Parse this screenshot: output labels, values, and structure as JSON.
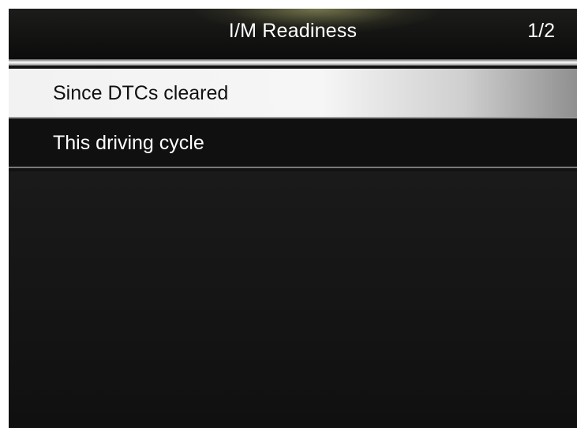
{
  "header": {
    "title": "I/M Readiness",
    "page_indicator": "1/2"
  },
  "menu": {
    "items": [
      {
        "label": "Since DTCs cleared",
        "selected": true
      },
      {
        "label": "This driving cycle",
        "selected": false
      }
    ]
  },
  "colors": {
    "background": "#121212",
    "header_glow": "#bebe78",
    "selected_row": "#f2f2f2",
    "text": "#ffffff",
    "selected_text": "#111111"
  }
}
